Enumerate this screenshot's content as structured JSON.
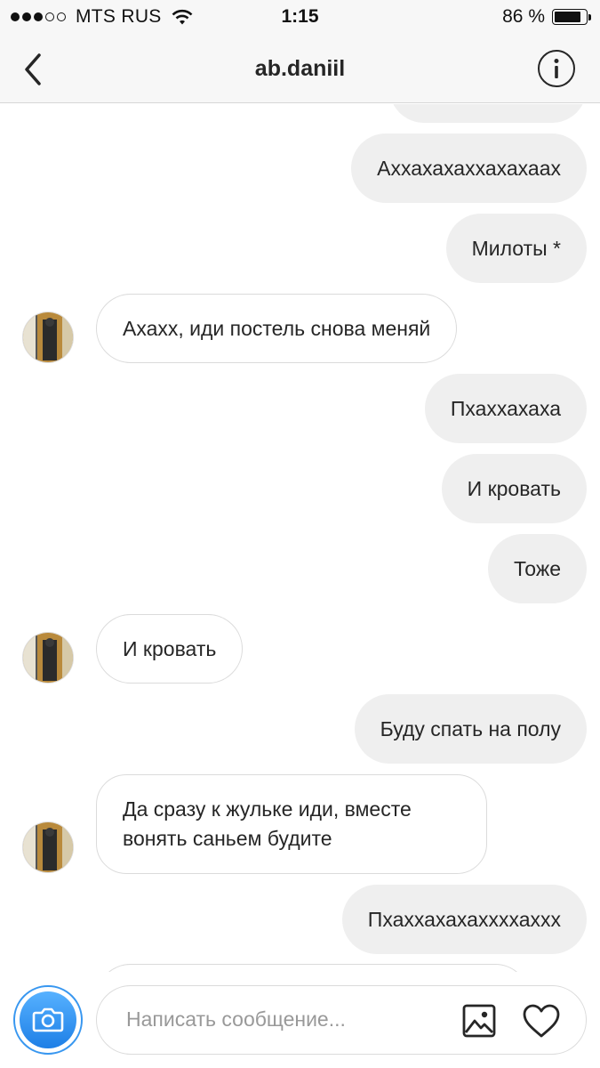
{
  "status_bar": {
    "carrier": "MTS RUS",
    "time": "1:15",
    "battery_percent": "86 %",
    "battery_level": 0.86,
    "signal_bars_filled": 3,
    "signal_bars_total": 5,
    "icons": [
      "signal-dots-icon",
      "wifi-icon",
      "battery-icon"
    ]
  },
  "header": {
    "title": "ab.daniil",
    "icons": [
      "back-chevron-icon",
      "info-icon"
    ]
  },
  "messages": [
    {
      "direction": "outgoing",
      "text": "Аххахахаххахахаах"
    },
    {
      "direction": "outgoing",
      "text": "Милоты *"
    },
    {
      "direction": "incoming",
      "text": "Ахахх, иди постель снова меняй"
    },
    {
      "direction": "outgoing",
      "text": "Пхаххахаха"
    },
    {
      "direction": "outgoing",
      "text": "И кровать"
    },
    {
      "direction": "outgoing",
      "text": "Тоже"
    },
    {
      "direction": "incoming",
      "text": "И кровать"
    },
    {
      "direction": "outgoing",
      "text": "Буду спать на полу"
    },
    {
      "direction": "incoming",
      "text": "Да сразу к жульке иди, вместе вонять саньем будите"
    },
    {
      "direction": "outgoing",
      "text": "Пхаххахахаххххаххх"
    }
  ],
  "composer": {
    "placeholder": "Написать сообщение...",
    "value": "",
    "icons": [
      "camera-icon",
      "gallery-icon",
      "heart-icon"
    ]
  },
  "colors": {
    "outgoing_bubble": "#efefef",
    "incoming_border": "#dbdbdb",
    "accent": "#3897f0",
    "text": "#262626",
    "placeholder": "#999999"
  }
}
